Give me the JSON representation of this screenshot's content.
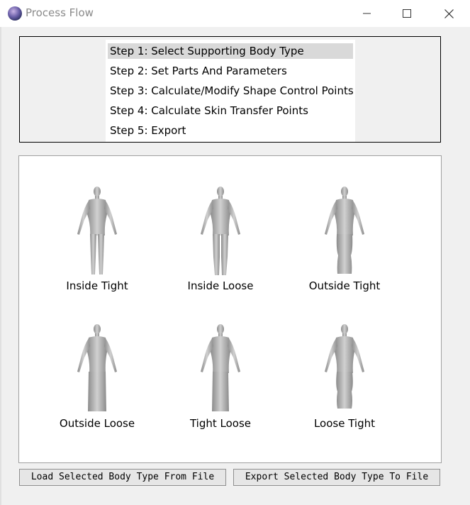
{
  "window": {
    "title": "Process Flow",
    "controls": {
      "minimize": "minimize-icon",
      "maximize": "maximize-icon",
      "close": "close-icon"
    }
  },
  "steps": {
    "items": [
      {
        "label": "Step 1: Select Supporting Body Type",
        "selected": true
      },
      {
        "label": "Step 2: Set Parts And Parameters",
        "selected": false
      },
      {
        "label": "Step 3: Calculate/Modify Shape Control Points",
        "selected": false
      },
      {
        "label": "Step 4: Calculate Skin Transfer Points",
        "selected": false
      },
      {
        "label": "Step 5: Export",
        "selected": false
      }
    ]
  },
  "body_types": {
    "items": [
      {
        "label": "Inside Tight",
        "figure": "fitted-legs"
      },
      {
        "label": "Inside Loose",
        "figure": "loose-legs"
      },
      {
        "label": "Outside Tight",
        "figure": "tight-column"
      },
      {
        "label": "Outside Loose",
        "figure": "loose-column"
      },
      {
        "label": "Tight Loose",
        "figure": "straight-column"
      },
      {
        "label": "Loose Tight",
        "figure": "tapered-column"
      }
    ]
  },
  "buttons": {
    "load_label": "Load Selected Body Type From File",
    "export_label": "Export Selected Body Type To File"
  },
  "colors": {
    "selection": "#d9d9d9",
    "figure": "#b8b8b8",
    "figure_shadow": "#8c8c8c"
  }
}
